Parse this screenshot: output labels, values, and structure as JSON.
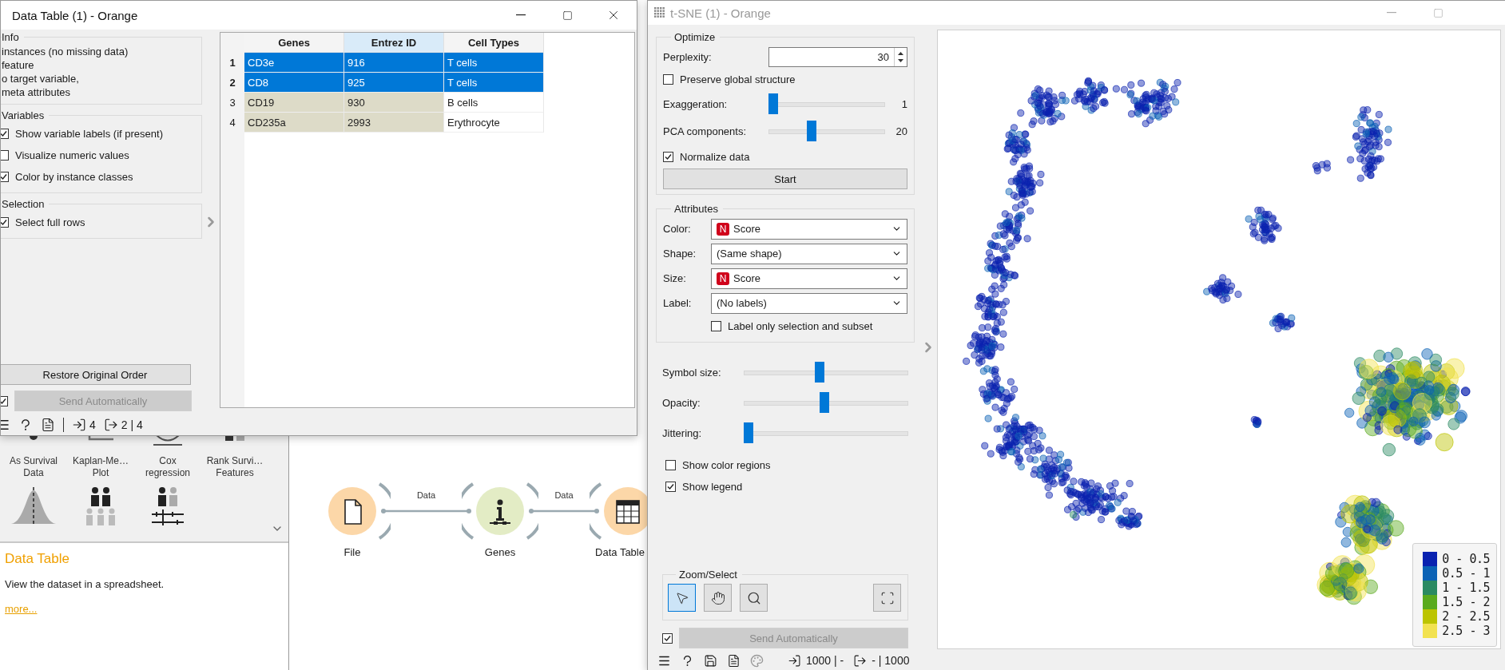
{
  "orange_canvas": {
    "widgets": [
      {
        "label": "As Survival Data"
      },
      {
        "label": "Kaplan-Me… Plot"
      },
      {
        "label": "Cox regression"
      },
      {
        "label": "Rank Survi… Features"
      }
    ],
    "description": {
      "title": "Data Table",
      "text": "View the dataset in a spreadsheet.",
      "link": "more..."
    },
    "workflow": {
      "nodes": [
        {
          "label": "File",
          "kind": "file"
        },
        {
          "label": "Genes",
          "kind": "info"
        },
        {
          "label": "Data Table",
          "kind": "table"
        }
      ],
      "links": [
        {
          "label": "Data"
        },
        {
          "label": "Data"
        }
      ]
    }
  },
  "data_table_window": {
    "title": "Data Table (1) - Orange",
    "info": {
      "title": "Info",
      "lines": [
        "instances (no missing data)",
        "feature",
        "o target variable,",
        "meta attributes"
      ]
    },
    "variables": {
      "title": "Variables",
      "options": [
        {
          "label": "Show variable labels (if present)",
          "checked": true
        },
        {
          "label": "Visualize numeric values",
          "checked": false
        },
        {
          "label": "Color by instance classes",
          "checked": true
        }
      ]
    },
    "selection": {
      "title": "Selection",
      "options": [
        {
          "label": "Select full rows",
          "checked": true
        }
      ]
    },
    "restore_button": "Restore Original Order",
    "send_automatically": {
      "label": "Send Automatically",
      "checked": true,
      "disabled": true
    },
    "table": {
      "columns": [
        {
          "label": "Genes",
          "meta": true,
          "highlighted": false
        },
        {
          "label": "Entrez ID",
          "meta": true,
          "highlighted": true
        },
        {
          "label": "Cell Types",
          "meta": false,
          "highlighted": false
        }
      ],
      "rows": [
        {
          "number": "1",
          "selected": true,
          "cells": [
            "CD3e",
            "916",
            "T cells"
          ]
        },
        {
          "number": "2",
          "selected": true,
          "cells": [
            "CD8",
            "925",
            "T cells"
          ]
        },
        {
          "number": "3",
          "selected": false,
          "cells": [
            "CD19",
            "930",
            "B cells"
          ]
        },
        {
          "number": "4",
          "selected": false,
          "cells": [
            "CD235a",
            "2993",
            "Erythrocyte"
          ]
        }
      ]
    },
    "status": {
      "input": "4",
      "output": "2 | 4"
    }
  },
  "tsne_window": {
    "title": "t-SNE (1) - Orange",
    "optimize": {
      "title": "Optimize",
      "perplexity_label": "Perplexity:",
      "perplexity": "30",
      "preserve_global": {
        "label": "Preserve global structure",
        "checked": false
      },
      "exaggeration": {
        "label": "Exaggeration:",
        "level": 0,
        "reading": "1"
      },
      "pca": {
        "label": "PCA components:",
        "level": 0.36,
        "reading": "20"
      },
      "normalize": {
        "label": "Normalize data",
        "checked": true
      },
      "start_button": "Start"
    },
    "attributes": {
      "title": "Attributes",
      "fields": [
        {
          "label": "Color:",
          "value": "Score",
          "badge": "N"
        },
        {
          "label": "Shape:",
          "value": "(Same shape)"
        },
        {
          "label": "Size:",
          "value": "Score",
          "badge": "N"
        },
        {
          "label": "Label:",
          "value": "(No labels)"
        }
      ],
      "label_only_selection": {
        "label": "Label only selection and subset",
        "checked": false
      }
    },
    "sliders": [
      {
        "label": "Symbol size:",
        "level": 0.46
      },
      {
        "label": "Opacity:",
        "level": 0.49
      },
      {
        "label": "Jittering:",
        "level": 0
      }
    ],
    "show_color_regions": {
      "label": "Show color regions",
      "checked": false
    },
    "show_legend": {
      "label": "Show legend",
      "checked": true
    },
    "zoom_select": {
      "title": "Zoom/Select",
      "tools": [
        {
          "kind": "select",
          "selected": true
        },
        {
          "kind": "pan",
          "selected": false
        },
        {
          "kind": "zoom",
          "selected": false
        }
      ]
    },
    "send_automatically": {
      "label": "Send Automatically",
      "checked": true,
      "disabled": true
    },
    "status": {
      "input": "1000 | -",
      "output": "- | 1000"
    },
    "legend": [
      {
        "label": "0 - 0.5",
        "color": "#0a22b0"
      },
      {
        "label": "0.5 - 1",
        "color": "#0b62b5"
      },
      {
        "label": "1 - 1.5",
        "color": "#2a8a62"
      },
      {
        "label": "1.5 - 2",
        "color": "#5aaa1e"
      },
      {
        "label": "2 - 2.5",
        "color": "#bcc400"
      },
      {
        "label": "2.5 - 3",
        "color": "#f2e250"
      }
    ]
  }
}
